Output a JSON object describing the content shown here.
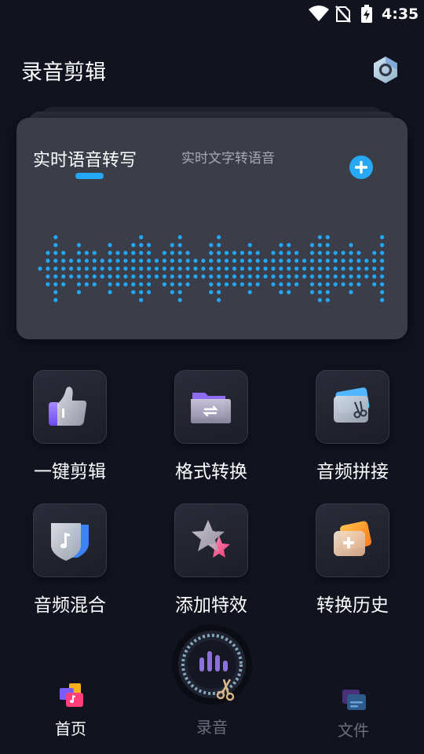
{
  "status_bar": {
    "time": "4:35"
  },
  "header": {
    "title": "录音剪辑"
  },
  "card": {
    "tab_active": "实时语音转写",
    "tab_inactive": "实时文字转语音",
    "accent_color": "#23a7f7",
    "waveform_levels": [
      0,
      0.5,
      1,
      0.6,
      0.3,
      0.7,
      0.6,
      0.4,
      0.2,
      0.7,
      0.4,
      0.6,
      0.8,
      1,
      0.7,
      0.3,
      0.5,
      0.7,
      0.9,
      0.6,
      0.3,
      0.3,
      0.7,
      1,
      0.6,
      0.4,
      0.6,
      0.8,
      0.5,
      0.2,
      0.5,
      0.7,
      0.8,
      0.6,
      0.3,
      0.7,
      0.9,
      0.9,
      0.5,
      0.6,
      0.7,
      0.4,
      0.3,
      0.6,
      0.9,
      0.6,
      0.7
    ]
  },
  "features": [
    {
      "label": "一键剪辑",
      "icon": "thumbs-up-icon"
    },
    {
      "label": "格式转换",
      "icon": "folder-convert-icon"
    },
    {
      "label": "音频拼接",
      "icon": "card-scissors-icon"
    },
    {
      "label": "音频混合",
      "icon": "music-shield-icon"
    },
    {
      "label": "添加特效",
      "icon": "star-effect-icon"
    },
    {
      "label": "转换历史",
      "icon": "history-card-icon"
    }
  ],
  "nav": {
    "home": "首页",
    "record": "录音",
    "files": "文件"
  }
}
